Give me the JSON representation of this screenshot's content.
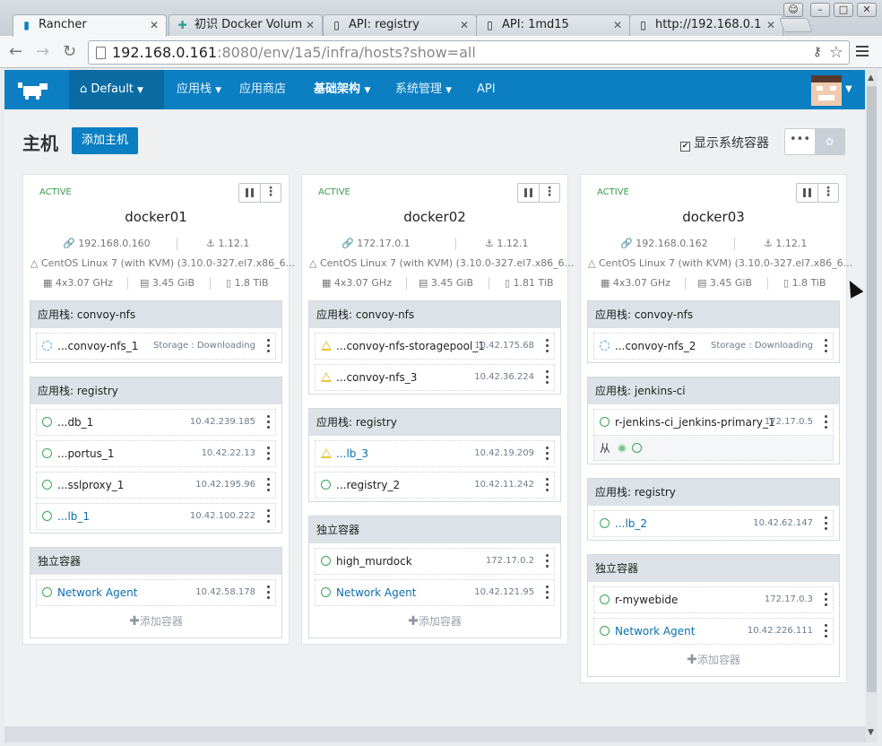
{
  "browser": {
    "tabs": [
      {
        "title": "Rancher",
        "active": true
      },
      {
        "title": "初识 Docker Volum",
        "active": false
      },
      {
        "title": "API: registry",
        "active": false
      },
      {
        "title": "API: 1md15",
        "active": false
      },
      {
        "title": "http://192.168.0.1",
        "active": false
      }
    ],
    "url_host": "192.168.0.161",
    "url_rest": ":8080/env/1a5/infra/hosts?show=all"
  },
  "nav": {
    "environment": "Default",
    "items": [
      "应用栈",
      "应用商店",
      "基础架构",
      "系统管理",
      "API"
    ]
  },
  "page": {
    "title": "主机",
    "add_host": "添加主机",
    "show_system": "显示系统容器",
    "add_container": "添加容器",
    "sidekick_label": "从"
  },
  "colors": {
    "accent": "#0b7fc1",
    "active": "#3a9a4e",
    "warning": "#e8c53e"
  },
  "hosts": [
    {
      "state": "ACTIVE",
      "name": "docker01",
      "ip": "192.168.0.160",
      "docker": "1.12.1",
      "os": "CentOS Linux 7 (with KVM) (3.10.0-327.el7.x86_6...",
      "cpu": "4x3.07 GHz",
      "mem": "3.45 GiB",
      "disk": "1.8 TiB",
      "groups": [
        {
          "title": "应用栈: convoy-nfs",
          "containers": [
            {
              "name": "...convoy-nfs_1",
              "ip": "Storage : Downloading",
              "status": "spin",
              "link": false
            }
          ]
        },
        {
          "title": "应用栈: registry",
          "containers": [
            {
              "name": "...db_1",
              "ip": "10.42.239.185",
              "status": "ok",
              "link": false
            },
            {
              "name": "...portus_1",
              "ip": "10.42.22.13",
              "status": "ok",
              "link": false
            },
            {
              "name": "...sslproxy_1",
              "ip": "10.42.195.96",
              "status": "ok",
              "link": false
            },
            {
              "name": "...lb_1",
              "ip": "10.42.100.222",
              "status": "ok",
              "link": true
            }
          ]
        },
        {
          "title": "独立容器",
          "add": true,
          "containers": [
            {
              "name": "Network Agent",
              "ip": "10.42.58.178",
              "status": "ok",
              "link": true
            }
          ]
        }
      ]
    },
    {
      "state": "ACTIVE",
      "name": "docker02",
      "ip": "172.17.0.1",
      "docker": "1.12.1",
      "os": "CentOS Linux 7 (with KVM) (3.10.0-327.el7.x86_6...",
      "cpu": "4x3.07 GHz",
      "mem": "3.45 GiB",
      "disk": "1.81 TiB",
      "groups": [
        {
          "title": "应用栈: convoy-nfs",
          "containers": [
            {
              "name": "...convoy-nfs-storagepool_1",
              "ip": "10.42.175.68",
              "status": "warn",
              "link": false
            },
            {
              "name": "...convoy-nfs_3",
              "ip": "10.42.36.224",
              "status": "warn",
              "link": false
            }
          ]
        },
        {
          "title": "应用栈: registry",
          "containers": [
            {
              "name": "...lb_3",
              "ip": "10.42.19.209",
              "status": "warn",
              "link": true
            },
            {
              "name": "...registry_2",
              "ip": "10.42.11.242",
              "status": "ok",
              "link": false
            }
          ]
        },
        {
          "title": "独立容器",
          "add": true,
          "containers": [
            {
              "name": "high_murdock",
              "ip": "172.17.0.2",
              "status": "ok",
              "link": false
            },
            {
              "name": "Network Agent",
              "ip": "10.42.121.95",
              "status": "ok",
              "link": true
            }
          ]
        }
      ]
    },
    {
      "state": "ACTIVE",
      "name": "docker03",
      "ip": "192.168.0.162",
      "docker": "1.12.1",
      "os": "CentOS Linux 7 (with KVM) (3.10.0-327.el7.x86_6...",
      "cpu": "4x3.07 GHz",
      "mem": "3.45 GiB",
      "disk": "1.8 TiB",
      "groups": [
        {
          "title": "应用栈: convoy-nfs",
          "containers": [
            {
              "name": "...convoy-nfs_2",
              "ip": "Storage : Downloading",
              "status": "spin",
              "link": false
            }
          ]
        },
        {
          "title": "应用栈: jenkins-ci",
          "containers": [
            {
              "name": "r-jenkins-ci_jenkins-primary_1",
              "ip": "172.17.0.5",
              "status": "ok",
              "link": false,
              "sidekick": true
            }
          ]
        },
        {
          "title": "应用栈: registry",
          "containers": [
            {
              "name": "...lb_2",
              "ip": "10.42.62.147",
              "status": "ok",
              "link": true
            }
          ]
        },
        {
          "title": "独立容器",
          "add": true,
          "containers": [
            {
              "name": "r-mywebide",
              "ip": "172.17.0.3",
              "status": "ok",
              "link": false
            },
            {
              "name": "Network Agent",
              "ip": "10.42.226.111",
              "status": "ok",
              "link": true
            }
          ]
        }
      ]
    }
  ]
}
